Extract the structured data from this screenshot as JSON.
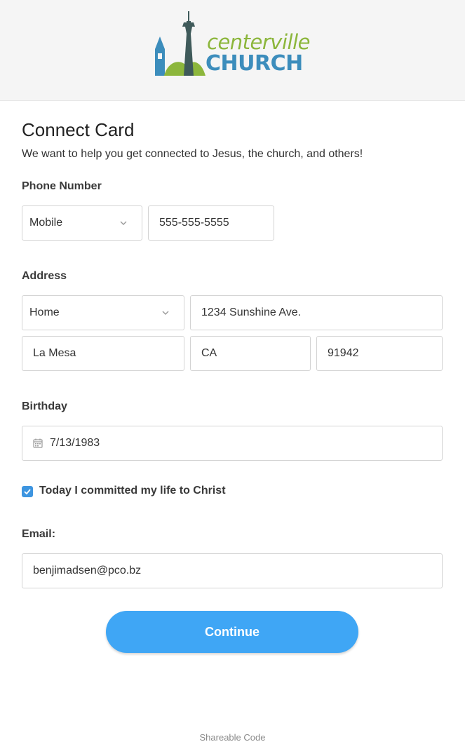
{
  "brand": {
    "name_top": "centerville",
    "name_bottom": "CHURCH",
    "colors": {
      "green": "#8cb63c",
      "blue": "#3c8dbc",
      "tower": "#3f5a5a"
    }
  },
  "form": {
    "title": "Connect Card",
    "subtitle": "We want to help you get connected to Jesus, the church, and others!",
    "phone": {
      "label": "Phone Number",
      "type_value": "Mobile",
      "number_value": "555-555-5555"
    },
    "address": {
      "label": "Address",
      "type_value": "Home",
      "street_value": "1234 Sunshine Ave.",
      "city_value": "La Mesa",
      "state_value": "CA",
      "zip_value": "91942"
    },
    "birthday": {
      "label": "Birthday",
      "value": "7/13/1983",
      "icon": "calendar-icon"
    },
    "commitment": {
      "checked": true,
      "label": "Today I committed my life to Christ"
    },
    "email": {
      "label": "Email:",
      "value": "benjimadsen@pco.bz"
    },
    "continue_label": "Continue",
    "accent_color": "#3fa6f5"
  },
  "footer": {
    "link_text": "Shareable Code"
  }
}
